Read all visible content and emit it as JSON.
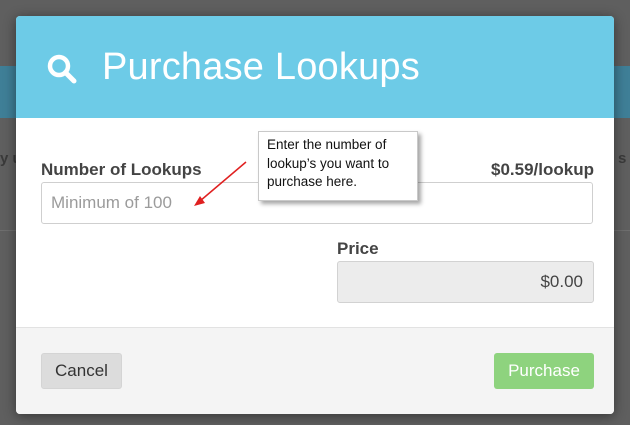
{
  "modal": {
    "title": "Purchase Lookups",
    "header_icon": "search-icon",
    "header_color": "#6dcbe7"
  },
  "form": {
    "lookups_label": "Number of Lookups",
    "lookups_value": "",
    "lookups_placeholder": "Minimum of 100",
    "rate_label": "$0.59/lookup",
    "price_label": "Price",
    "price_value": "$0.00"
  },
  "footer": {
    "cancel_label": "Cancel",
    "purchase_label": "Purchase",
    "purchase_color": "#8ed37e"
  },
  "annotation": {
    "text": "Enter the number of lookup’s you want to purchase here.",
    "arrow_color": "#e02020"
  }
}
